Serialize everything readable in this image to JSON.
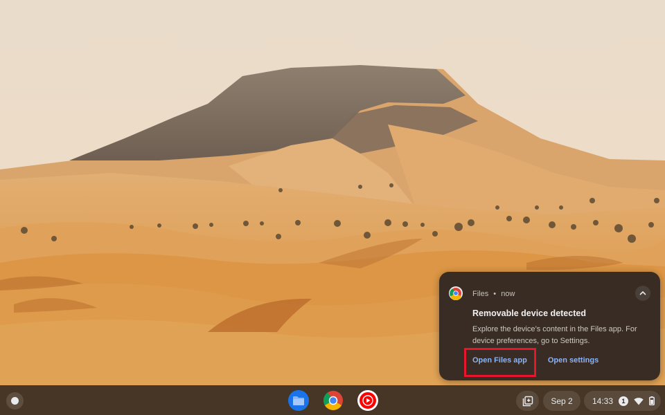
{
  "notification": {
    "app_name": "Files",
    "separator": "•",
    "time": "now",
    "title": "Removable device detected",
    "body": "Explore the device’s content in the Files app. For device preferences, go to Settings.",
    "actions": {
      "open_files": "Open Files app",
      "open_settings": "Open settings"
    }
  },
  "shelf": {
    "apps": [
      {
        "name": "Files",
        "icon": "folder-icon"
      },
      {
        "name": "Chrome",
        "icon": "chrome-icon"
      },
      {
        "name": "YouTube Music",
        "icon": "youtube-music-icon"
      }
    ],
    "date": "Sep 2",
    "time": "14:33",
    "notification_count": "1"
  },
  "colors": {
    "accent_link": "#8ab4f8",
    "highlight_border": "#e8162b",
    "notification_bg": "#2e2622"
  }
}
